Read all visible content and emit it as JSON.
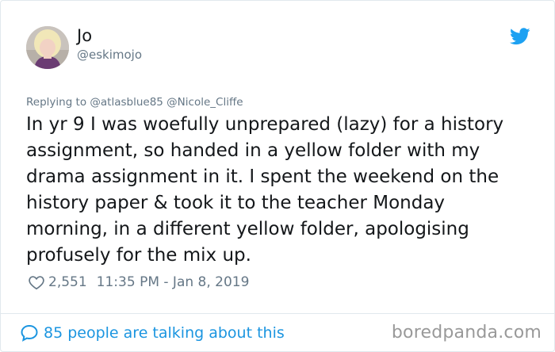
{
  "user": {
    "display_name": "Jo",
    "handle": "@eskimojo"
  },
  "reply": {
    "prefix": "Replying to",
    "mentions": "@atlasblue85 @Nicole_Cliffe"
  },
  "tweet": {
    "text": "In yr 9 I was woefully unprepared (lazy) for a history\nassignment, so handed in a yellow folder with my\ndrama assignment in it. I spent the weekend on the\nhistory paper & took it to the teacher Monday\nmorning, in a different yellow folder, apologising\nprofusely for the mix up."
  },
  "stats": {
    "likes": "2,551",
    "timestamp": "11:35 PM - Jan 8, 2019"
  },
  "footer": {
    "talking": "85 people are talking about this",
    "watermark": "boredpanda.com"
  },
  "icons": {
    "bird": "twitter-bird-icon",
    "heart": "heart-outline-icon",
    "bubble": "speech-bubble-icon"
  },
  "colors": {
    "twitter_blue": "#1da1f2",
    "link_blue": "#1b95e0",
    "secondary_text": "#657786",
    "primary_text": "#14171a",
    "watermark": "#999999"
  }
}
